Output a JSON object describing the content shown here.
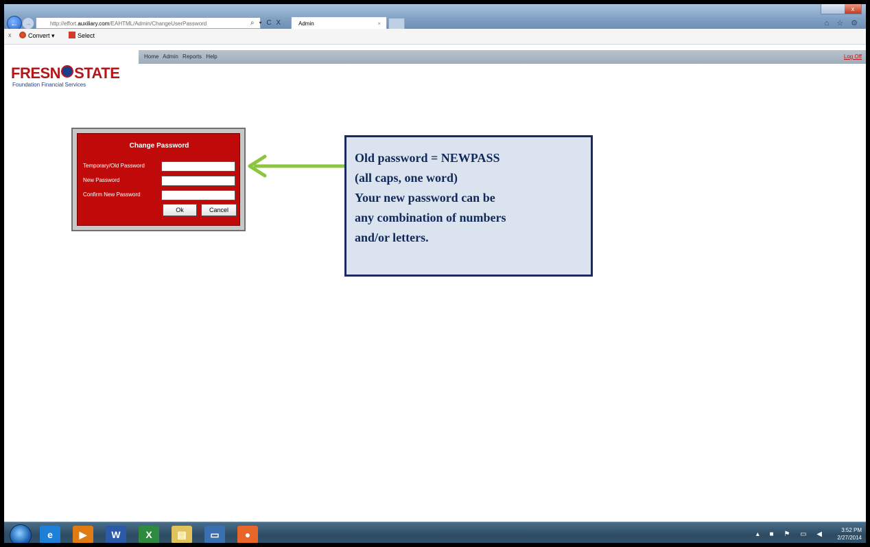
{
  "browser": {
    "url_prefix": "http://effort.",
    "url_domain": "auxiliary.com",
    "url_path": "/EAHTML/Admin/ChangeUserPassword",
    "address_icons": "⌕ ▾ C X",
    "tab_title": "Admin",
    "tab_close": "×",
    "right_icons": "⌂ ☆ ⚙"
  },
  "command_bar": {
    "close": "x",
    "convert_label": "Convert",
    "convert_arrow": "▾",
    "select_label": "Select"
  },
  "site": {
    "nav_items": [
      "Home",
      "Admin",
      "Reports",
      "Help"
    ],
    "logoff_label": "Log Off",
    "logo_text_left": "FRESN",
    "logo_text_right": "STATE",
    "logo_subtitle": "Foundation Financial Services"
  },
  "dialog": {
    "title": "Change Password",
    "fields": [
      {
        "label": "Temporary/Old Password",
        "value": ""
      },
      {
        "label": "New Password",
        "value": ""
      },
      {
        "label": "Confirm New Password",
        "value": ""
      }
    ],
    "ok_label": "Ok",
    "cancel_label": "Cancel",
    "bg_color": "#c00a0a"
  },
  "callout": {
    "lines": [
      "Old password = NEWPASS",
      "(all caps, one word)",
      "Your new password can be",
      "any combination of numbers",
      "and/or letters."
    ],
    "arrow_color": "#8cc63f"
  },
  "taskbar": {
    "apps": [
      {
        "name": "internet-explorer",
        "glyph": "e",
        "color": "#1e7fd6"
      },
      {
        "name": "media-player",
        "glyph": "▶",
        "color": "#e07a12"
      },
      {
        "name": "word",
        "glyph": "W",
        "color": "#2a5aa8"
      },
      {
        "name": "excel",
        "glyph": "X",
        "color": "#2e8a3e"
      },
      {
        "name": "file-explorer",
        "glyph": "▤",
        "color": "#e2c25a"
      },
      {
        "name": "remote-desktop",
        "glyph": "▭",
        "color": "#3a6fb0"
      },
      {
        "name": "firefox",
        "glyph": "●",
        "color": "#e8662a"
      }
    ],
    "tray_icons": "▴ ■ ⚑ ▭ ◀",
    "time": "3:52 PM",
    "date": "2/27/2014"
  }
}
